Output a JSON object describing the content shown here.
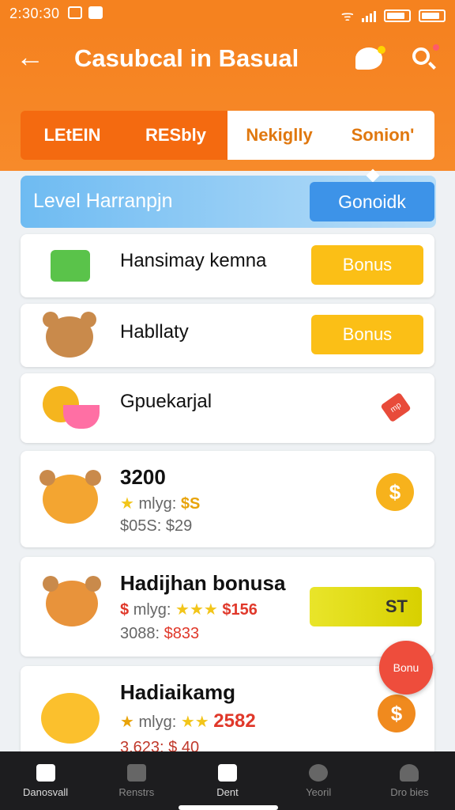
{
  "status": {
    "time": "2:30:30"
  },
  "header": {
    "title": "Casubcal in Basual",
    "tabs": [
      "LEtEIN",
      "RESbly",
      "Nekiglly",
      "Sonion'"
    ],
    "active_tab_count": 2
  },
  "level": {
    "label": "Level Harranpjn",
    "button": "Gonoidk"
  },
  "cards": [
    {
      "name": "Hansimay kemna",
      "button": "Bonus"
    },
    {
      "name": "Habllaty",
      "button": "Bonus"
    },
    {
      "name": "Gpuekarjal",
      "tag": "mp"
    },
    {
      "name": "3200",
      "sub_prefix": "mlyg:",
      "sub_value": "$S",
      "price": "$05S: $29"
    },
    {
      "name": "Hadijhan bonusa",
      "sub_prefix": "mlyg:",
      "sub_value": "$156",
      "price_prefix": "3088:",
      "price_value": "$833",
      "button": "ST"
    },
    {
      "name": "Hadiaikamg",
      "sub_prefix": "mlyg:",
      "sub_value": "2582",
      "price": "3,623: $ 40"
    }
  ],
  "fab": {
    "label": "Bonu"
  },
  "coin_symbol": "$",
  "nav": [
    {
      "label": "Danosvall",
      "icon": "home-icon"
    },
    {
      "label": "Renstrs",
      "icon": "shop-icon"
    },
    {
      "label": "Dent",
      "icon": "card-icon"
    },
    {
      "label": "Yeoril",
      "icon": "clock-icon"
    },
    {
      "label": "Dro bies",
      "icon": "profile-icon"
    }
  ],
  "colors": {
    "brand": "#f58220",
    "accent_blue": "#3d93e8",
    "bonus_yellow": "#fbbf16"
  }
}
